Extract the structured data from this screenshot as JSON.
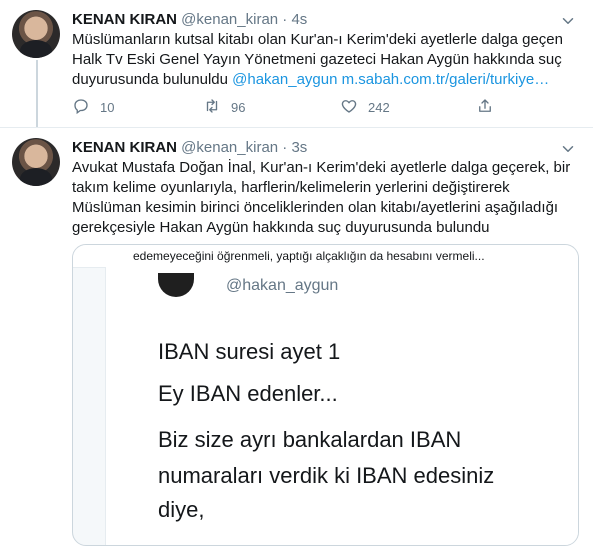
{
  "tweet1": {
    "name": "KENAN KIRAN",
    "handle": "@kenan_kiran",
    "dot": "·",
    "time": "4s",
    "text_lines": [
      "Müslümanların kutsal kitabı olan Kur'an-ı Kerim'deki ayetlerle dalga geçen",
      "Halk Tv Eski Genel Yayın Yönetmeni gazeteci Hakan Aygün hakkında suç"
    ],
    "text_line3_plain": "duyurusunda bulunuldu ",
    "mention": "@hakan_aygun",
    "url": " m.sabah.com.tr/galeri/turkiye…",
    "reply_count": "10",
    "retweet_count": "96",
    "like_count": "242"
  },
  "tweet2": {
    "name": "KENAN KIRAN",
    "handle": "@kenan_kiran",
    "dot": "·",
    "time": "3s",
    "text_lines": [
      "Avukat Mustafa Doğan İnal, Kur'an-ı Kerim'deki ayetlerle dalga geçerek, bir",
      "takım kelime oyunlarıyla, harflerin/kelimelerin yerlerini değiştirerek",
      "Müslüman kesimin birinci önceliklerinden olan kitabı/ayetlerini aşağıladığı",
      "gerekçesiyle Hakan Aygün hakkında suç duyurusunda bulundu"
    ],
    "media": {
      "top_text": "edemeyeceğini öğrenmeli, yaptığı alçaklığın da hesabını vermeli...",
      "handle": "@hakan_aygun",
      "lines": [
        "IBAN suresi ayet 1",
        "Ey IBAN edenler...",
        "Biz size ayrı bankalardan IBAN",
        "numaraları verdik ki IBAN edesiniz",
        "diye,"
      ]
    }
  },
  "icons": {
    "reply": "reply-icon",
    "retweet": "retweet-icon",
    "like": "heart-icon",
    "share": "share-icon",
    "more": "chevron-down-icon"
  },
  "colors": {
    "link": "#1b95e0",
    "muted": "#657786",
    "border": "#e6ecf0",
    "thread": "#ccd6dd"
  }
}
